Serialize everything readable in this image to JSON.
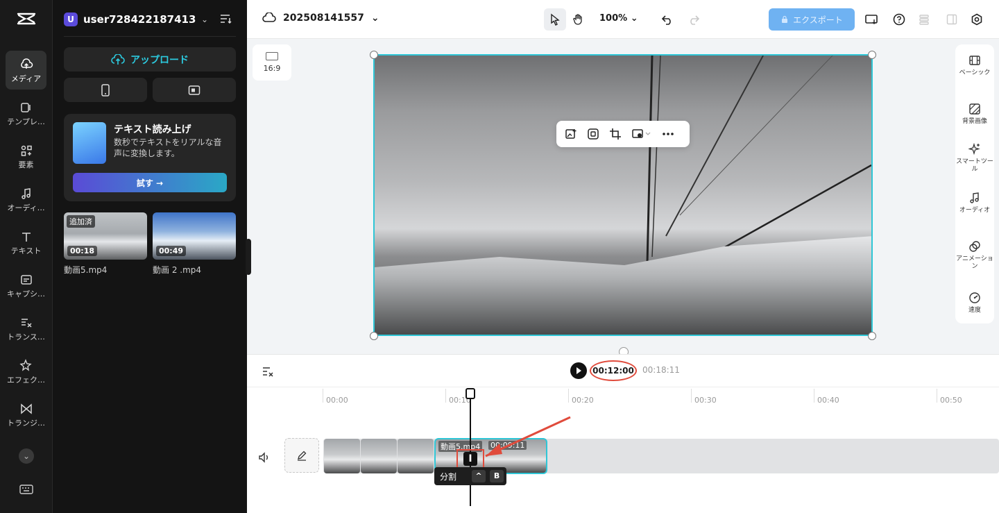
{
  "rail": {
    "logo": "capcut-logo",
    "items": [
      {
        "label": "メディア",
        "icon": "cloud-media-icon",
        "active": true
      },
      {
        "label": "テンプレ…",
        "icon": "template-icon",
        "active": false
      },
      {
        "label": "要素",
        "icon": "elements-icon",
        "active": false
      },
      {
        "label": "オーディ…",
        "icon": "music-icon",
        "active": false
      },
      {
        "label": "テキスト",
        "icon": "text-icon",
        "active": false
      },
      {
        "label": "キャプシ…",
        "icon": "caption-icon",
        "active": false
      },
      {
        "label": "トランス…",
        "icon": "transcript-icon",
        "active": false
      },
      {
        "label": "エフェク…",
        "icon": "effects-icon",
        "active": false
      },
      {
        "label": "トランジ…",
        "icon": "transition-icon",
        "active": false
      }
    ]
  },
  "panel": {
    "user_initial": "U",
    "user_name": "user7284221874131...",
    "upload_label": "アップロード",
    "tts": {
      "title": "テキスト読み上げ",
      "desc": "数秒でテキストをリアルな音声に変換します。",
      "button": "試す →"
    },
    "media": [
      {
        "name": "動画5.mp4",
        "duration": "00:18",
        "badge": "追加済"
      },
      {
        "name": "動画 2 .mp4",
        "duration": "00:49",
        "badge": ""
      }
    ]
  },
  "topbar": {
    "project_name": "202508141557",
    "zoom": "100%",
    "export_label": "エクスポート"
  },
  "canvas": {
    "ratio_label": "16:9"
  },
  "right_tools": [
    {
      "label": "ベーシック",
      "icon": "film-icon"
    },
    {
      "label": "背景画像",
      "icon": "background-icon"
    },
    {
      "label": "スマートツール",
      "icon": "sparkle-icon"
    },
    {
      "label": "オーディオ",
      "icon": "music-icon"
    },
    {
      "label": "アニメーション",
      "icon": "animation-icon"
    },
    {
      "label": "速度",
      "icon": "speed-icon"
    }
  ],
  "timeline": {
    "current_time": "00:12:00",
    "total_time": "00:18:11",
    "ticks": [
      "00:00",
      "00:10",
      "00:20",
      "00:30",
      "00:40",
      "00:50"
    ],
    "clip_label": "動画5.mp4",
    "clip_duration": "00:09:11",
    "tooltip_label": "分割",
    "tooltip_key": "B",
    "accent": "#2fc6d6",
    "highlight": "#e04b3c"
  }
}
